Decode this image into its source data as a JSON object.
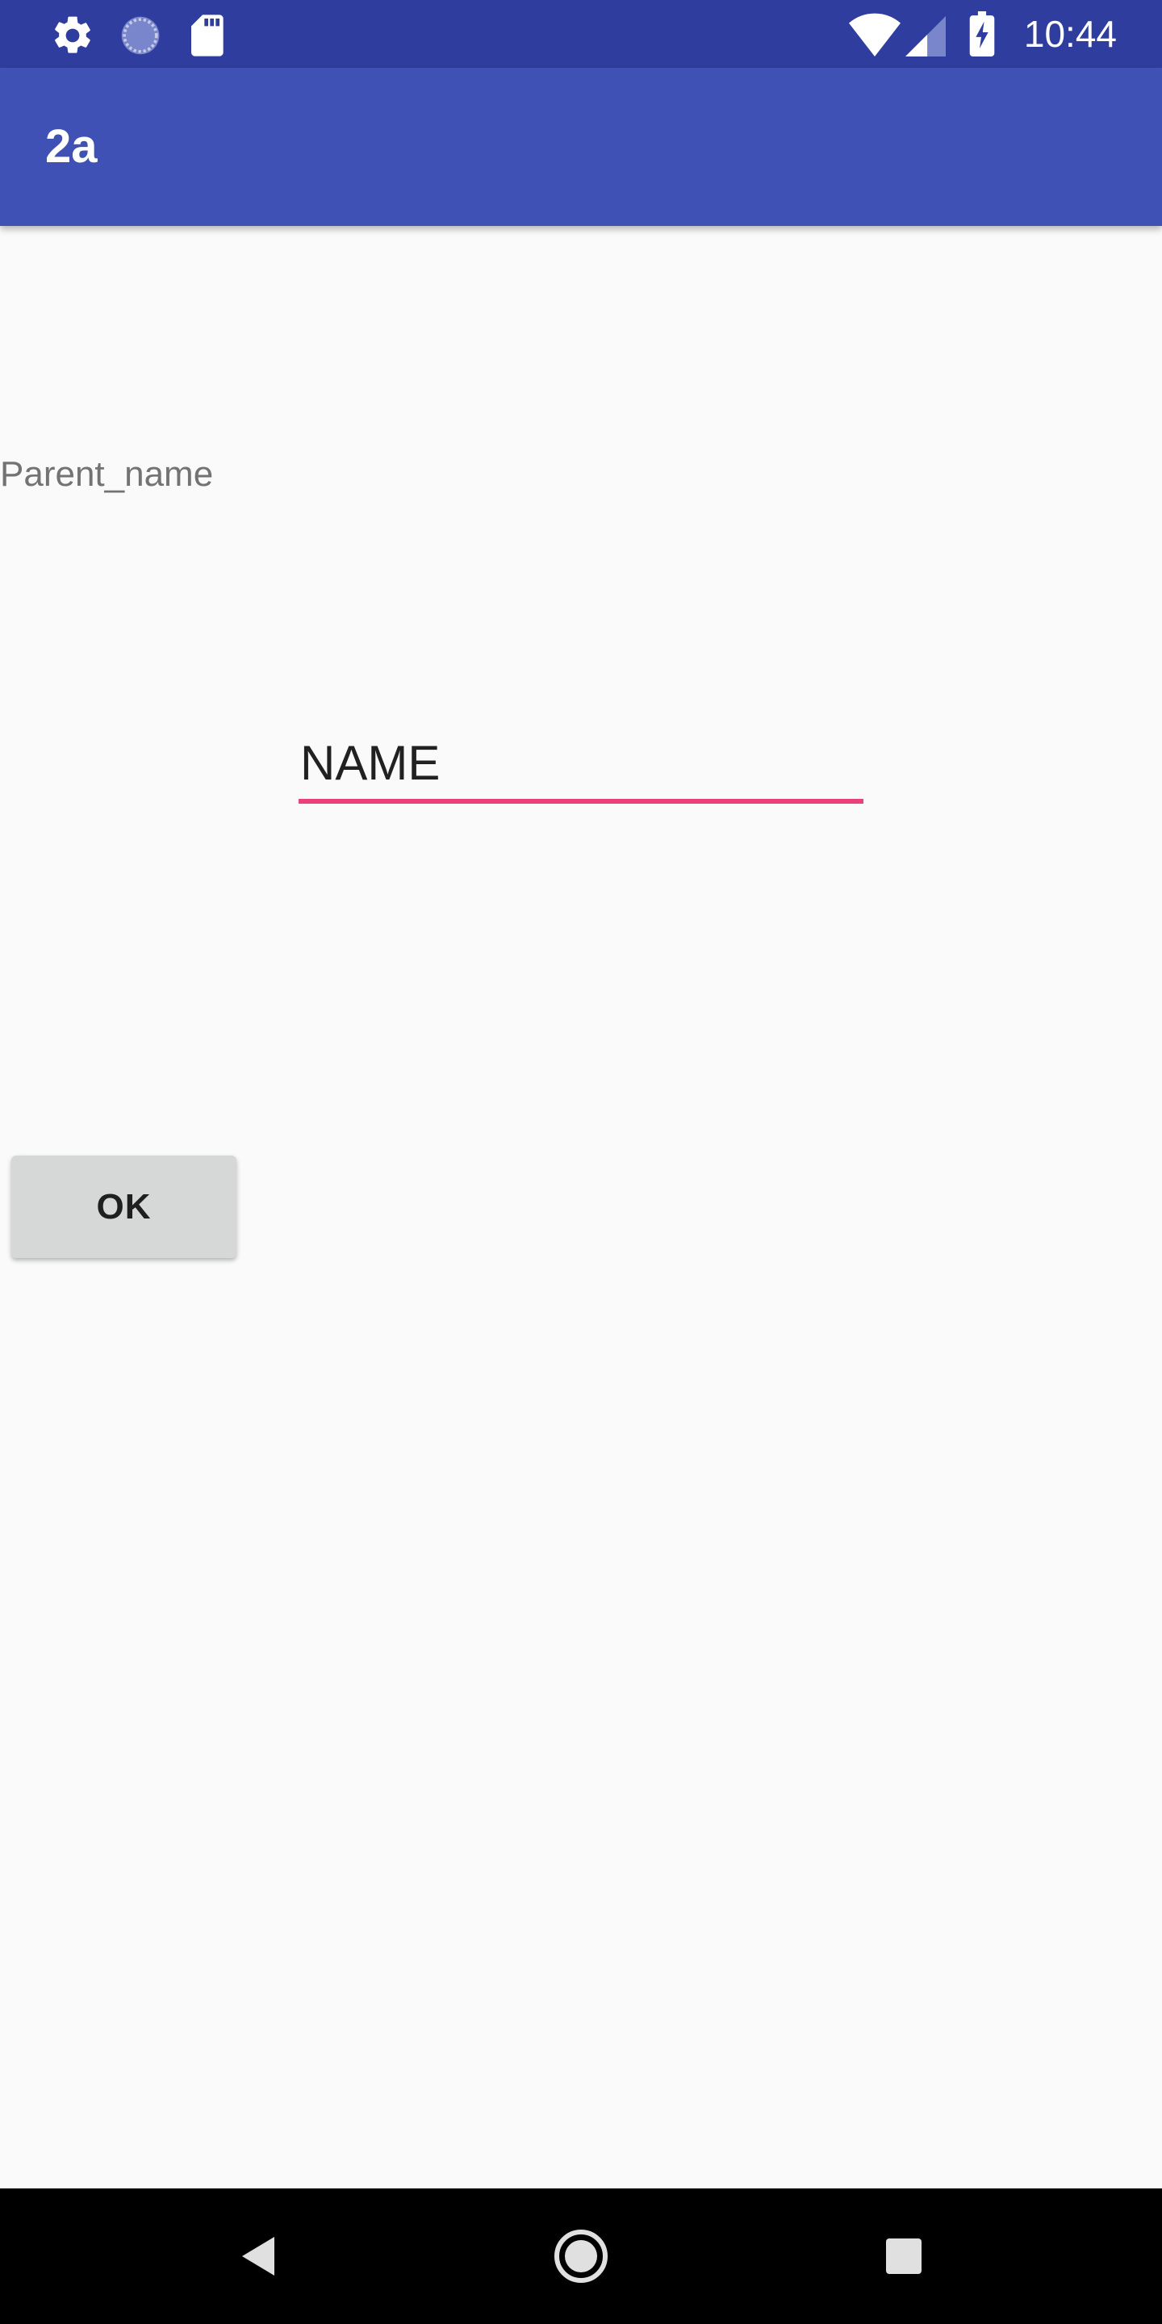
{
  "status_bar": {
    "time": "10:44",
    "left_icons": [
      "settings-gear-icon",
      "sync-progress-icon",
      "sd-card-icon"
    ],
    "right_icons": [
      "wifi-icon",
      "cell-signal-icon",
      "battery-charging-icon"
    ]
  },
  "app_bar": {
    "title": "2a",
    "background": "#3f51b5"
  },
  "content": {
    "parent_label": "Parent_name",
    "name_input": {
      "value": "NAME",
      "underline_color": "#ec407a"
    },
    "ok_button_label": "OK"
  },
  "nav_bar": {
    "buttons": [
      "back-icon",
      "home-icon",
      "recents-icon"
    ]
  }
}
